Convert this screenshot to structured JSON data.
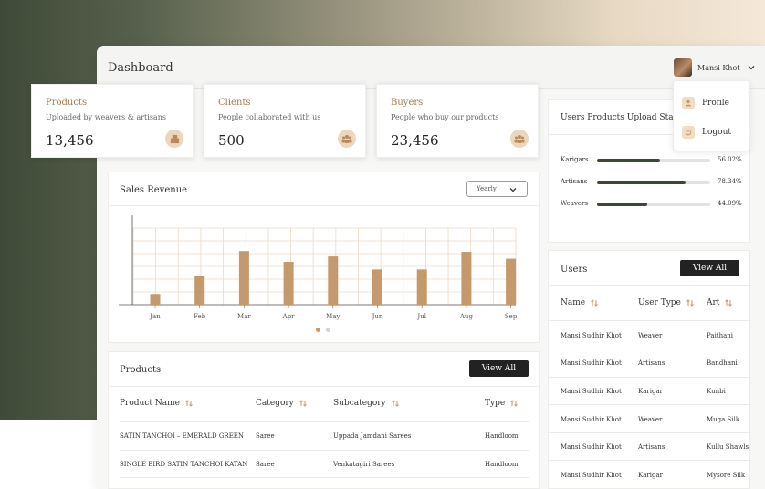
{
  "header": {
    "title": "Dashboard",
    "user_name": "Mansi Khot"
  },
  "user_menu": {
    "items": [
      {
        "label": "Profile",
        "icon": "user-icon"
      },
      {
        "label": "Logout",
        "icon": "power-icon"
      }
    ]
  },
  "stats": [
    {
      "title": "Products",
      "subtitle": "Uploaded by weavers & artisans",
      "value": "13,456",
      "icon": "box-icon"
    },
    {
      "title": "Clients",
      "subtitle": "People collaborated with us",
      "value": "500",
      "icon": "people-icon"
    },
    {
      "title": "Buyers",
      "subtitle": "People who buy our products",
      "value": "23,456",
      "icon": "people-icon"
    }
  ],
  "sales": {
    "title": "Sales Revenue",
    "period_selected": "Yearly",
    "carousel_active_index": 0,
    "carousel_count": 2
  },
  "chart_data": {
    "type": "bar",
    "categories": [
      "Jan",
      "Feb",
      "Mar",
      "Apr",
      "May",
      "Jun",
      "Jul",
      "Aug",
      "Sep"
    ],
    "values": [
      14,
      37,
      70,
      56,
      63,
      46,
      46,
      69,
      60
    ],
    "ylim": [
      0,
      100
    ],
    "grid": true,
    "bar_color": "#c49a6c"
  },
  "upload_status": {
    "title": "Users Products Upload Status",
    "rows": [
      {
        "label": "Karigars",
        "value": 56.02,
        "display": "56.02%"
      },
      {
        "label": "Artisans",
        "value": 78.34,
        "display": "78.34%"
      },
      {
        "label": "Weavers",
        "value": 44.09,
        "display": "44.09%"
      }
    ]
  },
  "users": {
    "title": "Users",
    "view_all_label": "View All",
    "columns": [
      "Name",
      "User Type",
      "Art"
    ],
    "rows": [
      [
        "Mansi Sudhir Khot",
        "Weaver",
        "Paithani"
      ],
      [
        "Mansi Sudhir Khot",
        "Artisans",
        "Bandhani"
      ],
      [
        "Mansi Sudhir Khot",
        "Karigar",
        "Kunbi"
      ],
      [
        "Mansi Sudhir Khot",
        "Weaver",
        "Muga Silk"
      ],
      [
        "Mansi Sudhir Khot",
        "Artisans",
        "Kullu Shawls"
      ],
      [
        "Mansi Sudhir Khot",
        "Karigar",
        "Mysore Silk"
      ]
    ]
  },
  "products": {
    "title": "Products",
    "view_all_label": "View All",
    "columns": [
      "Product Name",
      "Category",
      "Subcategory",
      "Type"
    ],
    "rows": [
      [
        "SATIN TANCHOI – EMERALD GREEN",
        "Saree",
        "Uppada Jamdani Sarees",
        "Handloom"
      ],
      [
        "SINGLE BIRD SATIN TANCHOI KATAN",
        "Saree",
        "Venkatagiri Sarees",
        "Handloom"
      ]
    ]
  },
  "colors": {
    "accent": "#a4794d",
    "icon_bg": "#ecd6bd",
    "dark": "#222222",
    "progress": "#3d4736"
  }
}
